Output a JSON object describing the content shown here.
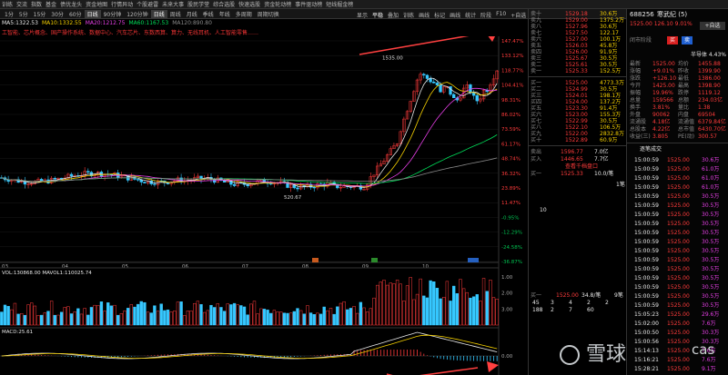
{
  "topbar": [
    "训练",
    "交流",
    "指数",
    "基金",
    "债优龙头",
    "资金地图",
    "行情异动",
    "个股避雷",
    "未来大事",
    "股民学堂",
    "综合选股",
    "快速选股",
    "资金轮动榜",
    "事件驱动榜",
    "短线掘金榜"
  ],
  "periods": [
    "1分",
    "5分",
    "15分",
    "30分",
    "60分",
    "日线",
    "90分钟",
    "120分钟",
    "日线",
    "周线",
    "月线",
    "季线",
    "年线",
    "多周期",
    "周期切换"
  ],
  "active_period": "日线",
  "chart_tools": [
    "显示",
    "平稳",
    "叠加",
    "训练",
    "画线",
    "标记",
    "画线",
    "统计",
    "阶段",
    "F10",
    "+自选"
  ],
  "active_tool": "平稳",
  "ma_legend": [
    {
      "t": "MA5:1322.53",
      "c": "#e8e8e8"
    },
    {
      "t": "MA10:1332.55",
      "c": "#f5d000"
    },
    {
      "t": "MA20:1212.75",
      "c": "#e63fe6"
    },
    {
      "t": "MA60:1167.53",
      "c": "#00e05a"
    },
    {
      "t": "MA120:890.80",
      "c": "#888888"
    }
  ],
  "tags": "工智能、芯片概念、国产操作系统、数据中心、汽车芯片、东数西算、算力、无线耳机、人工智能零售……",
  "price_axis": [
    "147.47%",
    "133.12%",
    "118.77%",
    "104.41%",
    "98.31%",
    "86.02%",
    "73.59%",
    "61.17%",
    "48.74%",
    "36.32%",
    "23.89%",
    "11.47%",
    "-0.95%",
    "-12.29%",
    "-24.58%",
    "-36.87%"
  ],
  "vol_axis": [
    "1.00",
    "2.00",
    "3.00"
  ],
  "macd_axis": [
    "0.00"
  ],
  "months": [
    "03",
    "04",
    "05",
    "06",
    "07",
    "08",
    "09",
    "10"
  ],
  "high_label": "1535.00",
  "low_label": "520.67",
  "vol_legend": "VOL:130868.00  MAVOL1:110025.74",
  "macd_legend": "MACD:25.61",
  "stock": {
    "code": "688256",
    "name": "寒武纪",
    "rank": "(5)",
    "price": "1525.00",
    "chg": "126.10",
    "pct": "9.01%",
    "add": "+自选"
  },
  "watch_label": "闭市阶段",
  "buy_btn": "买",
  "sell_btn": "卖",
  "half": "半导体",
  "half_pct": "4.43%",
  "asks": [
    [
      "卖十",
      "1529.18",
      "30.6万"
    ],
    [
      "卖九",
      "1529.00",
      "1375.2万"
    ],
    [
      "卖八",
      "1527.96",
      "30.6万"
    ],
    [
      "卖七",
      "1527.50",
      "122.17"
    ],
    [
      "卖六",
      "1527.00",
      "100.1万"
    ],
    [
      "卖五",
      "1526.03",
      "45.8万"
    ],
    [
      "卖四",
      "1526.00",
      "91.9万"
    ],
    [
      "卖三",
      "1525.67",
      "30.5万"
    ],
    [
      "卖二",
      "1525.61",
      "30.5万"
    ],
    [
      "卖一",
      "1525.33",
      "152.5万"
    ]
  ],
  "bids": [
    [
      "买一",
      "1525.00",
      "4773.3万"
    ],
    [
      "买二",
      "1524.99",
      "30.5万"
    ],
    [
      "买三",
      "1524.01",
      "198.1万"
    ],
    [
      "买四",
      "1524.00",
      "137.2万"
    ],
    [
      "买五",
      "1523.30",
      "91.4万"
    ],
    [
      "买六",
      "1523.00",
      "155.3万"
    ],
    [
      "买七",
      "1522.99",
      "30.5万"
    ],
    [
      "买八",
      "1522.10",
      "106.5万"
    ],
    [
      "买九",
      "1522.00",
      "2832.8万"
    ],
    [
      "买十",
      "1522.89",
      "60.9万"
    ]
  ],
  "quote_stats": [
    [
      "最新",
      "1525.00",
      "均价",
      "1455.88"
    ],
    [
      "涨幅",
      "+9.01%",
      "昨收",
      "1399.90"
    ],
    [
      "涨跌",
      "+126.10",
      "最低",
      "1386.00"
    ],
    [
      "今开",
      "1425.00",
      "最高",
      "1398.90"
    ],
    [
      "振幅",
      "19.96%",
      "跌停",
      "1119.12"
    ],
    [
      "总量",
      "159566",
      "总额",
      "234.03亿"
    ],
    [
      "换手",
      "3.81%",
      "量比",
      "1.38"
    ],
    [
      "外盘",
      "90062",
      "内盘",
      "69504"
    ],
    [
      "流通股",
      "4.18亿",
      "流通值",
      "6379.84亿"
    ],
    [
      "总股本",
      "4.22亿",
      "总市值",
      "6430.70亿"
    ],
    [
      "收益(三)",
      "3.805",
      "PE(动)",
      "300.57"
    ]
  ],
  "deal_title": "逐笔成交",
  "deals": [
    [
      "15:00:59",
      "1525.00",
      "30.6万"
    ],
    [
      "15:00:59",
      "1525.00",
      "61.0万"
    ],
    [
      "15:00:59",
      "1525.00",
      "61.0万"
    ],
    [
      "15:00:59",
      "1525.00",
      "61.0万"
    ],
    [
      "15:00:59",
      "1525.00",
      "30.5万"
    ],
    [
      "15:00:59",
      "1525.00",
      "30.5万"
    ],
    [
      "15:00:59",
      "1525.00",
      "30.5万"
    ],
    [
      "15:00:59",
      "1525.00",
      "30.5万"
    ],
    [
      "15:00:59",
      "1525.00",
      "30.5万"
    ],
    [
      "15:00:59",
      "1525.00",
      "30.5万"
    ],
    [
      "15:00:59",
      "1525.00",
      "30.5万"
    ],
    [
      "15:00:59",
      "1525.00",
      "30.5万"
    ],
    [
      "15:00:59",
      "1525.00",
      "30.5万"
    ],
    [
      "15:00:59",
      "1525.00",
      "30.5万"
    ],
    [
      "15:00:59",
      "1525.00",
      "30.5万"
    ],
    [
      "15:00:59",
      "1525.00",
      "30.5万"
    ],
    [
      "15:00:59",
      "1525.00",
      "30.5万"
    ],
    [
      "15:05:23",
      "1525.00",
      "29.6万"
    ],
    [
      "15:02:00",
      "1525.00",
      "7.6万"
    ],
    [
      "15:00:50",
      "1525.00",
      "30.3万"
    ],
    [
      "15:00:56",
      "1525.00",
      "30.3万"
    ],
    [
      "15:14:13",
      "1525.00",
      "7.6万"
    ],
    [
      "15:16:21",
      "1525.00",
      "7.6万"
    ],
    [
      "15:28:21",
      "1525.00",
      "9.1万"
    ]
  ],
  "order_rows": [
    [
      "卖出",
      "1596.77",
      "7.0亿"
    ],
    [
      "买入",
      "1446.65",
      "7.7亿"
    ],
    [
      "",
      "查看千档盘口",
      ""
    ],
    [
      "买一",
      "1525.33",
      "10.0/笔"
    ]
  ],
  "order_foot": [
    "1笔",
    "9笔"
  ],
  "book_mini": {
    "label": "买一",
    "price": "1525.00",
    "val": "34.8/笔",
    "grid": [
      [
        "45",
        "3",
        "4",
        "2",
        "2"
      ],
      [
        "188",
        "2",
        "7",
        "60",
        ""
      ]
    ]
  },
  "watermark": "雪球",
  "wm_tail": "cas"
}
